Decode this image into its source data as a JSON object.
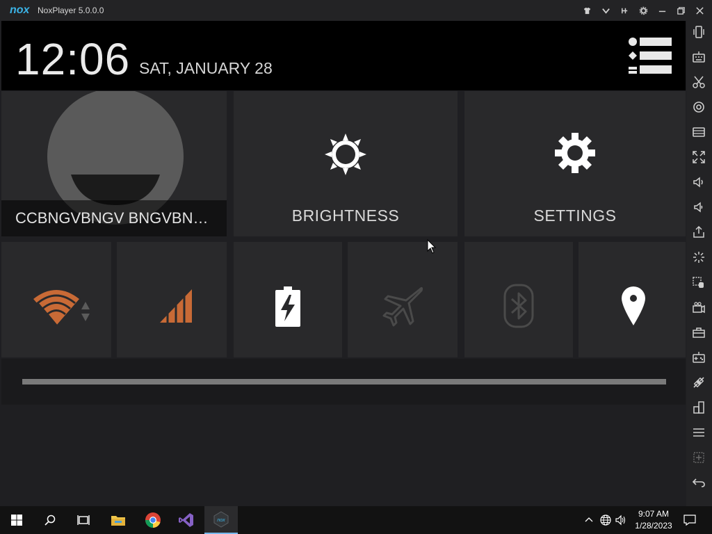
{
  "window": {
    "title": "NoxPlayer 5.0.0.0",
    "logo_text": "nox"
  },
  "statusbar": {
    "time": "12:06",
    "date": "SAT, JANUARY 28"
  },
  "tiles": {
    "user_name": "CCBNGVBNGV BNGVBN…",
    "brightness_label": "BRIGHTNESS",
    "settings_label": "SETTINGS"
  },
  "quick_settings": [
    {
      "icon": "wifi-icon",
      "color": "#c86a36"
    },
    {
      "icon": "signal-icon",
      "color": "#c86a36"
    },
    {
      "icon": "battery-charging-icon",
      "color": "#ffffff"
    },
    {
      "icon": "airplane-mode-icon",
      "color": "#4a4a4a"
    },
    {
      "icon": "bluetooth-icon",
      "color": "#4a4a4a"
    },
    {
      "icon": "location-icon",
      "color": "#ffffff"
    }
  ],
  "toolbar_icons": [
    "shake-icon",
    "keyboard-icon",
    "scissors-icon",
    "location-icon",
    "screenshot-icon",
    "fullscreen-icon",
    "volume-up-icon",
    "volume-down-icon",
    "apk-install-icon",
    "loading-icon",
    "multi-instance-icon",
    "video-record-icon",
    "toolbox-icon",
    "gamepad-icon",
    "connect-icon",
    "multi-window-icon",
    "menu-icon",
    "add-icon",
    "back-icon"
  ],
  "taskbar": {
    "time": "9:07 AM",
    "date": "1/28/2023"
  },
  "colors": {
    "accent": "#3bb3e6",
    "wifi_orange": "#c86a36",
    "tile_bg": "#29292b"
  }
}
